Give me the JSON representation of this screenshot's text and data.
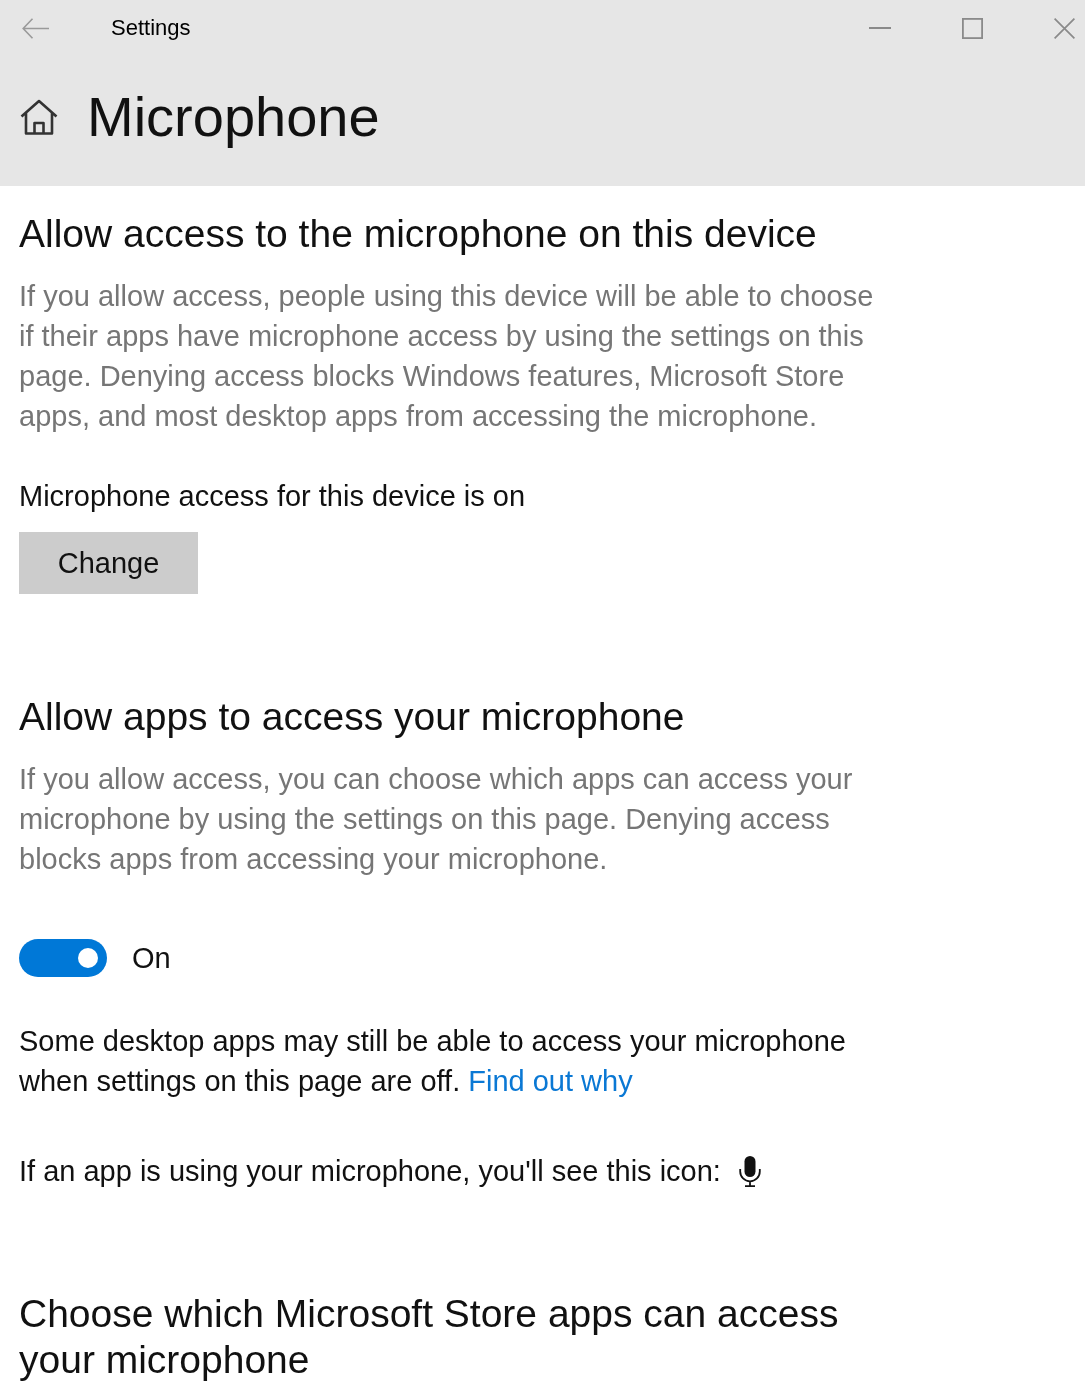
{
  "window": {
    "title": "Settings"
  },
  "header": {
    "title": "Microphone"
  },
  "blocks": [
    {
      "kind": "heading",
      "text": "Allow access to the microphone on this device"
    },
    {
      "kind": "description",
      "text": "If you allow access, people using this device will be able to choose if their apps have microphone access by using the settings on this page. Denying access blocks Windows features, Microsoft Store apps, and most desktop apps from accessing the microphone."
    },
    {
      "kind": "status",
      "text": "Microphone access for this device is on"
    },
    {
      "kind": "button",
      "label": "Change"
    },
    {
      "kind": "heading",
      "text": "Allow apps to access your microphone"
    },
    {
      "kind": "description",
      "text": "If you allow access, you can choose which apps can access your microphone by using the settings on this page. Denying access blocks apps from accessing your microphone."
    },
    {
      "kind": "toggle",
      "on": true,
      "label": "On"
    },
    {
      "kind": "note",
      "text": "Some desktop apps may still be able to access your microphone when settings on this page are off.",
      "link": "Find out why"
    },
    {
      "kind": "icon_note",
      "text": "If an app is using your microphone, you'll see this icon:"
    },
    {
      "kind": "heading",
      "text": "Choose which Microsoft Store apps can access your microphone"
    }
  ]
}
